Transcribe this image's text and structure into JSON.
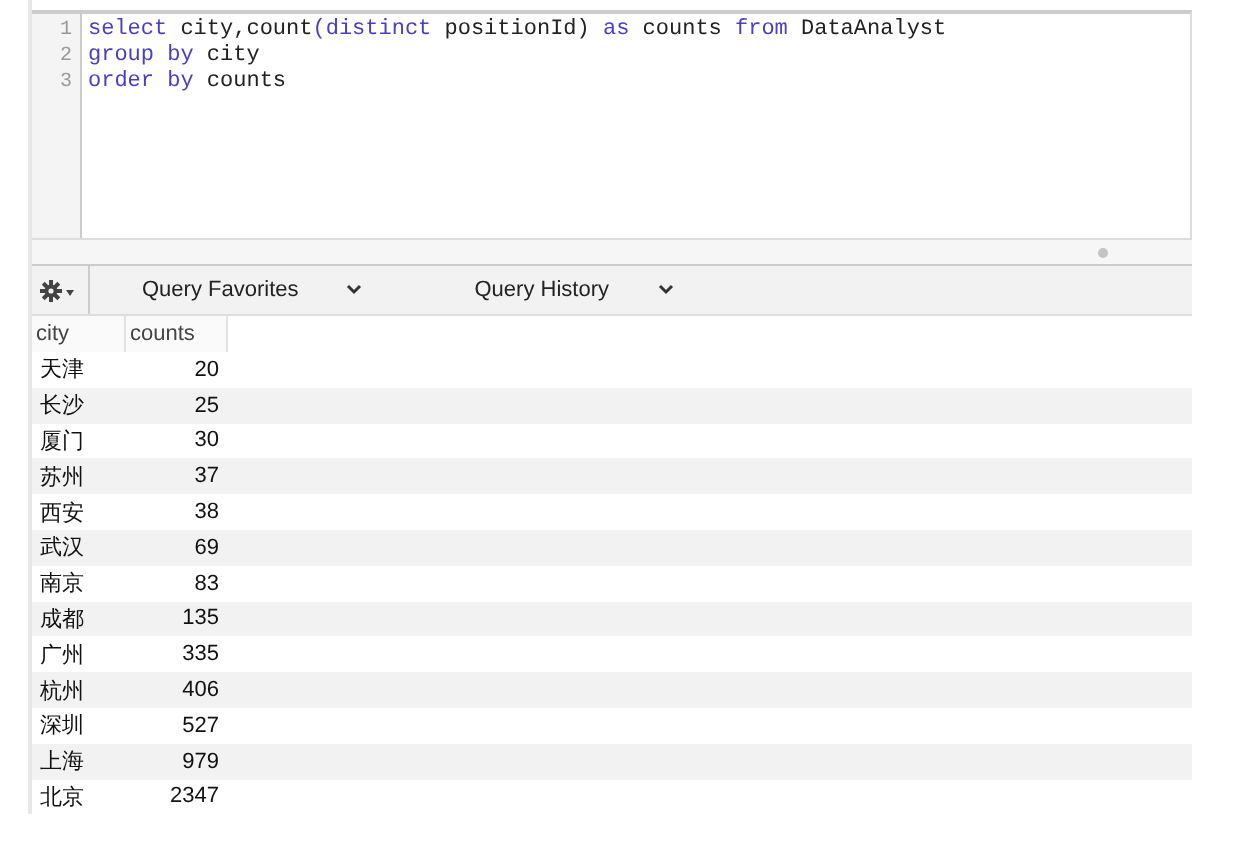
{
  "editor": {
    "lines": [
      {
        "number": "1",
        "tokens": [
          {
            "text": "select",
            "kind": "keyword"
          },
          {
            "text": " city,count",
            "kind": "plain"
          },
          {
            "text": "(",
            "kind": "keyword"
          },
          {
            "text": "distinct",
            "kind": "keyword"
          },
          {
            "text": " positionId) ",
            "kind": "plain"
          },
          {
            "text": "as",
            "kind": "keyword"
          },
          {
            "text": " counts ",
            "kind": "plain"
          },
          {
            "text": "from",
            "kind": "keyword"
          },
          {
            "text": " DataAnalyst",
            "kind": "plain"
          }
        ]
      },
      {
        "number": "2",
        "tokens": [
          {
            "text": "group by",
            "kind": "keyword"
          },
          {
            "text": " city",
            "kind": "plain"
          }
        ]
      },
      {
        "number": "3",
        "tokens": [
          {
            "text": "order by",
            "kind": "keyword"
          },
          {
            "text": " counts",
            "kind": "plain"
          }
        ]
      }
    ]
  },
  "toolbar": {
    "menus": [
      "Query Favorites",
      "Query History"
    ]
  },
  "table": {
    "columns": [
      "city",
      "counts"
    ],
    "rows": [
      [
        "天津",
        "20"
      ],
      [
        "长沙",
        "25"
      ],
      [
        "厦门",
        "30"
      ],
      [
        "苏州",
        "37"
      ],
      [
        "西安",
        "38"
      ],
      [
        "武汉",
        "69"
      ],
      [
        "南京",
        "83"
      ],
      [
        "成都",
        "135"
      ],
      [
        "广州",
        "335"
      ],
      [
        "杭州",
        "406"
      ],
      [
        "深圳",
        "527"
      ],
      [
        "上海",
        "979"
      ],
      [
        "北京",
        "2347"
      ]
    ]
  }
}
